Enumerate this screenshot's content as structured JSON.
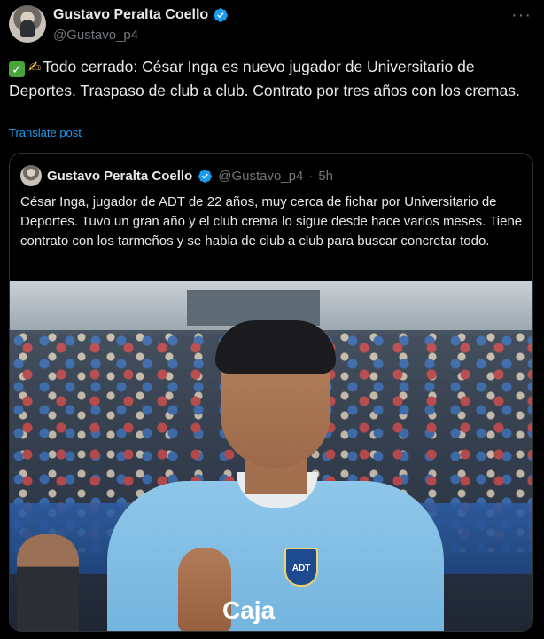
{
  "tweet": {
    "author_name": "Gustavo Peralta Coello",
    "handle": "@Gustavo_p4",
    "more_label": "···",
    "text": "Todo cerrado: César Inga es nuevo jugador de Universitario de Deportes. Traspaso de club a club. Contrato por tres años con los cremas.",
    "translate_label": "Translate post"
  },
  "quote": {
    "author_name": "Gustavo Peralta Coello",
    "handle": "@Gustavo_p4",
    "separator": "·",
    "time": "5h",
    "text": "César Inga, jugador de ADT de 22 años, muy cerca de fichar por Universitario de Deportes. Tuvo un gran año y el club crema lo sigue desde hace varios meses. Tiene contrato con los tarmeños y se habla de club a club para buscar concretar todo.",
    "image": {
      "badge_text": "ADT",
      "sponsor_text": "Caja"
    }
  },
  "colors": {
    "background": "#000000",
    "text": "#e7e9ea",
    "muted": "#71767b",
    "link": "#1d9bf0",
    "verified": "#1d9bf0",
    "border": "#2f3336"
  },
  "icons": {
    "verified": "verified-badge-icon",
    "check_emoji": "check-mark-button-emoji",
    "writing_hand_emoji": "writing-hand-emoji",
    "more": "more-options-icon"
  }
}
